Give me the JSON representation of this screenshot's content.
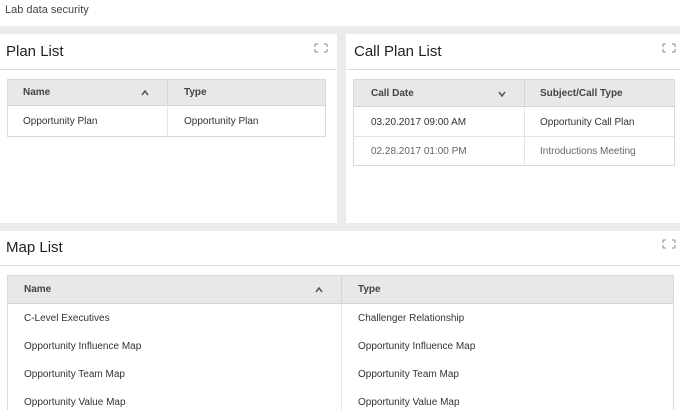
{
  "page": {
    "title": "Lab data security"
  },
  "plan_list": {
    "title": "Plan List",
    "columns": [
      "Name",
      "Type"
    ],
    "rows": [
      {
        "name": "Opportunity Plan",
        "type": "Opportunity Plan"
      }
    ]
  },
  "call_plan_list": {
    "title": "Call Plan List",
    "columns": [
      "Call Date",
      "Subject/Call Type"
    ],
    "rows": [
      {
        "date": "03.20.2017 09:00 AM",
        "type": "Opportunity Call Plan"
      },
      {
        "date": "02.28.2017 01:00 PM",
        "type": "Introductions Meeting"
      }
    ]
  },
  "map_list": {
    "title": "Map List",
    "columns": [
      "Name",
      "Type"
    ],
    "rows": [
      {
        "name": "C-Level Executives",
        "type": "Challenger Relationship"
      },
      {
        "name": "Opportunity Influence Map",
        "type": "Opportunity Influence Map"
      },
      {
        "name": "Opportunity Team Map",
        "type": "Opportunity Team Map"
      },
      {
        "name": "Opportunity Value Map",
        "type": "Opportunity Value Map"
      }
    ]
  },
  "icons": {
    "expand": "expand-icon",
    "sort_asc": "chevron-up-icon",
    "sort_desc": "chevron-down-icon"
  }
}
